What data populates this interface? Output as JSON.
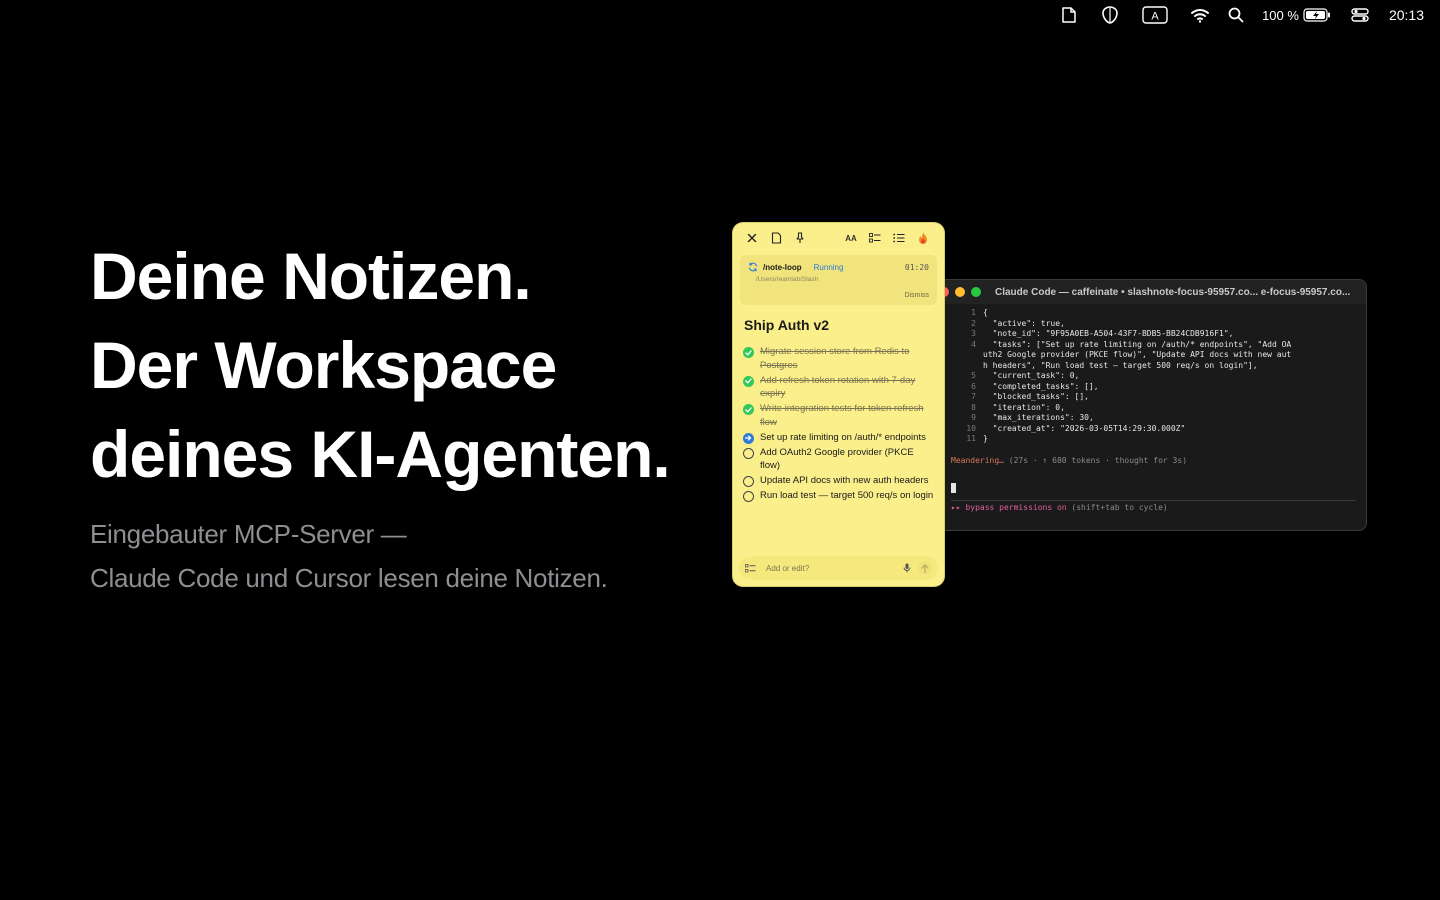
{
  "menubar": {
    "icons": [
      "note-icon",
      "shield-icon",
      "input-source-icon",
      "wifi-icon",
      "search-icon",
      "battery-icon",
      "control-center-icon"
    ],
    "input_source": "A",
    "battery": "100 %",
    "clock": "20:13"
  },
  "hero": {
    "lines": [
      "Deine Notizen.",
      "Der Workspace",
      "deines KI-Agenten."
    ],
    "sub": [
      "Eingebauter MCP-Server —",
      "Claude Code und Cursor lesen deine Notizen."
    ]
  },
  "note": {
    "toolbar": {
      "close_icon": "close-icon",
      "doc_icon": "document-icon",
      "pin_icon": "pin-icon",
      "font": "AA",
      "checklist_icon": "checklist-icon",
      "list_icon": "list-icon",
      "flame_icon": "flame-icon"
    },
    "loop": {
      "command": "/note-loop",
      "state": "Running",
      "time": "01:20",
      "path": "/Users/reamlab/Slash",
      "dismiss": "Dismiss"
    },
    "title": "Ship Auth v2",
    "tasks": [
      {
        "text": "Migrate session store from Redis to Postgres",
        "status": "done"
      },
      {
        "text": "Add refresh token rotation with 7-day expiry",
        "status": "done"
      },
      {
        "text": "Write integration tests for token refresh flow",
        "status": "done"
      },
      {
        "text": "Set up rate limiting on /auth/* endpoints",
        "status": "active"
      },
      {
        "text": "Add OAuth2 Google provider (PKCE flow)",
        "status": "open"
      },
      {
        "text": "Update API docs with new auth headers",
        "status": "open"
      },
      {
        "text": "Run load test — target 500 req/s on login",
        "status": "open"
      }
    ],
    "input_placeholder": "Add or edit?"
  },
  "terminal": {
    "title": "Claude Code — caffeinate • slashnote-focus-95957.co... e-focus-95957.co...",
    "lines": [
      {
        "n": "1",
        "code": "{"
      },
      {
        "n": "2",
        "code": "  \"active\": true,"
      },
      {
        "n": "3",
        "code": "  \"note_id\": \"9F95A0EB-A504-43F7-BDB5-BB24CDB916F1\","
      },
      {
        "n": "4",
        "code": "  \"tasks\": [\"Set up rate limiting on /auth/* endpoints\", \"Add OA"
      },
      {
        "n": "",
        "code": "uth2 Google provider (PKCE flow)\", \"Update API docs with new aut"
      },
      {
        "n": "",
        "code": "h headers\", \"Run load test — target 500 req/s on login\"],"
      },
      {
        "n": "5",
        "code": "  \"current_task\": 0,"
      },
      {
        "n": "6",
        "code": "  \"completed_tasks\": [],"
      },
      {
        "n": "7",
        "code": "  \"blocked_tasks\": [],"
      },
      {
        "n": "8",
        "code": "  \"iteration\": 0,"
      },
      {
        "n": "9",
        "code": "  \"max_iterations\": 30,"
      },
      {
        "n": "10",
        "code": "  \"created_at\": \"2026-03-05T14:29:30.000Z\""
      },
      {
        "n": "11",
        "code": "}"
      }
    ],
    "status_word": "Meandering…",
    "status_rest": " (27s · ↑ 680 tokens · thought for 3s)",
    "perm_prefix": "▸▸ bypass permissions on",
    "perm_rest": " (shift+tab to cycle)"
  },
  "colors": {
    "background": "#000000",
    "note_yellow": "#fbef8b",
    "done_green": "#34c759",
    "active_blue": "#2f7ad9",
    "terminal_bg": "#1a1a1a",
    "accent_orange": "#d97757",
    "perm_pink": "#e0609a"
  }
}
